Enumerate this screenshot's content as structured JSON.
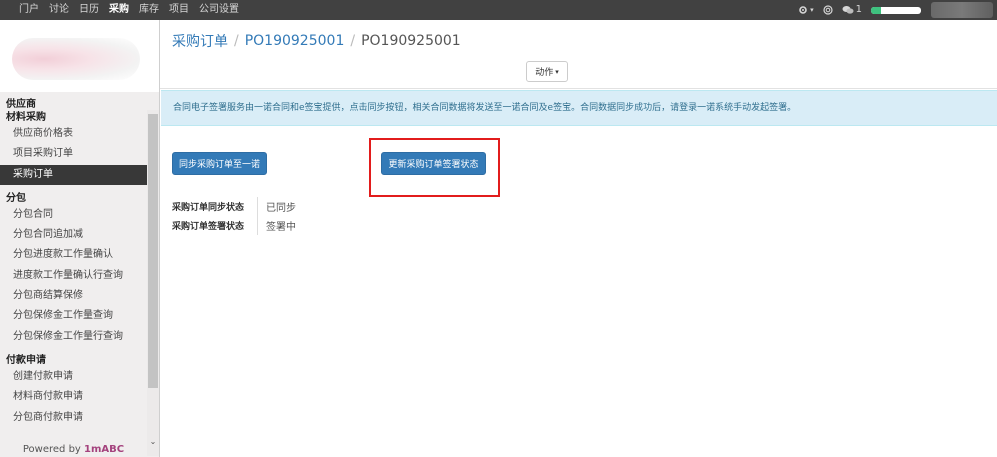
{
  "topnav": {
    "items": [
      "门户",
      "讨论",
      "日历",
      "采购",
      "库存",
      "项目",
      "公司设置"
    ],
    "active_index": 3
  },
  "topright": {
    "settings_caret": "▾",
    "chat_count": "1",
    "progress_fraction": 0.2
  },
  "sidebar": {
    "sections": [
      {
        "title": "供应商",
        "items": []
      },
      {
        "title": "材料采购",
        "items": [
          "供应商价格表",
          "项目采购订单",
          "采购订单"
        ]
      },
      {
        "title": "分包",
        "items": [
          "分包合同",
          "分包合同追加减",
          "分包进度款工作量确认",
          "进度款工作量确认行查询",
          "分包商结算保修",
          "分包保修金工作量查询",
          "分包保修金工作量行查询"
        ]
      },
      {
        "title": "付款申请",
        "items": [
          "创建付款申请",
          "材料商付款申请",
          "分包商付款申请"
        ]
      }
    ],
    "active_item": "采购订单",
    "powered_by": "Powered by",
    "brand": "1mABC"
  },
  "breadcrumb": {
    "root": "采购订单",
    "middle": "PO190925001",
    "current": "PO190925001",
    "separator": "/"
  },
  "action_button": {
    "label": "动作",
    "caret": "▾"
  },
  "alert": {
    "text": "合同电子签署服务由一诺合同和e签宝提供，点击同步按钮，相关合同数据将发送至一诺合同及e签宝。合同数据同步成功后，请登录一诺系统手动发起签署。"
  },
  "buttons": {
    "sync": "同步采购订单至一诺",
    "update": "更新采购订单签署状态"
  },
  "status": {
    "sync_label": "采购订单同步状态",
    "sync_value": "已同步",
    "sign_label": "采购订单签署状态",
    "sign_value": "签署中"
  }
}
